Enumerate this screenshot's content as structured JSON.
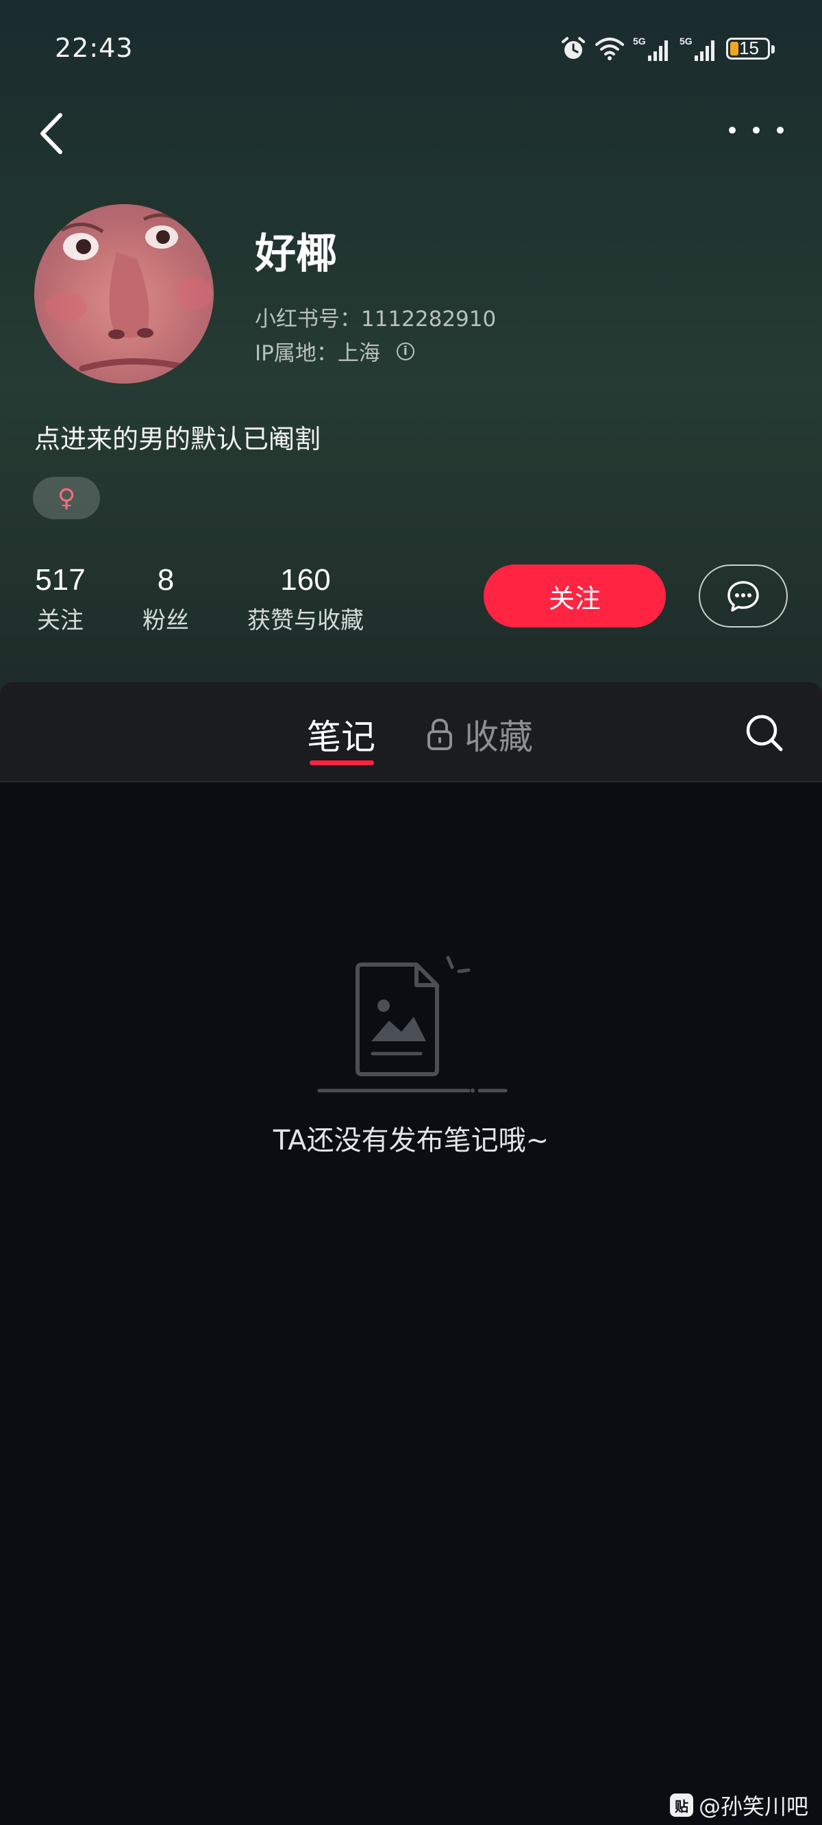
{
  "status_bar": {
    "time": "22:43",
    "battery": "15",
    "network_1": "5G",
    "network_2": "5G"
  },
  "profile": {
    "name": "好椰",
    "redbook_id": "小红书号：1112282910",
    "ip_location": "IP属地：上海",
    "bio": "点进来的男的默认已阉割",
    "gender_symbol": "♀"
  },
  "stats": [
    {
      "value": "517",
      "label": "关注"
    },
    {
      "value": "8",
      "label": "粉丝"
    },
    {
      "value": "160",
      "label": "获赞与收藏"
    }
  ],
  "actions": {
    "follow_label": "关注"
  },
  "tabs": {
    "notes": "笔记",
    "collections": "收藏"
  },
  "empty_state": {
    "message": "TA还没有发布笔记哦~"
  },
  "watermark": {
    "logo_text": "贴",
    "text": "@孙笑川吧"
  },
  "colors": {
    "accent": "#ff2442",
    "background": "#0a0d12",
    "tab_bar": "#1b1c1e"
  }
}
